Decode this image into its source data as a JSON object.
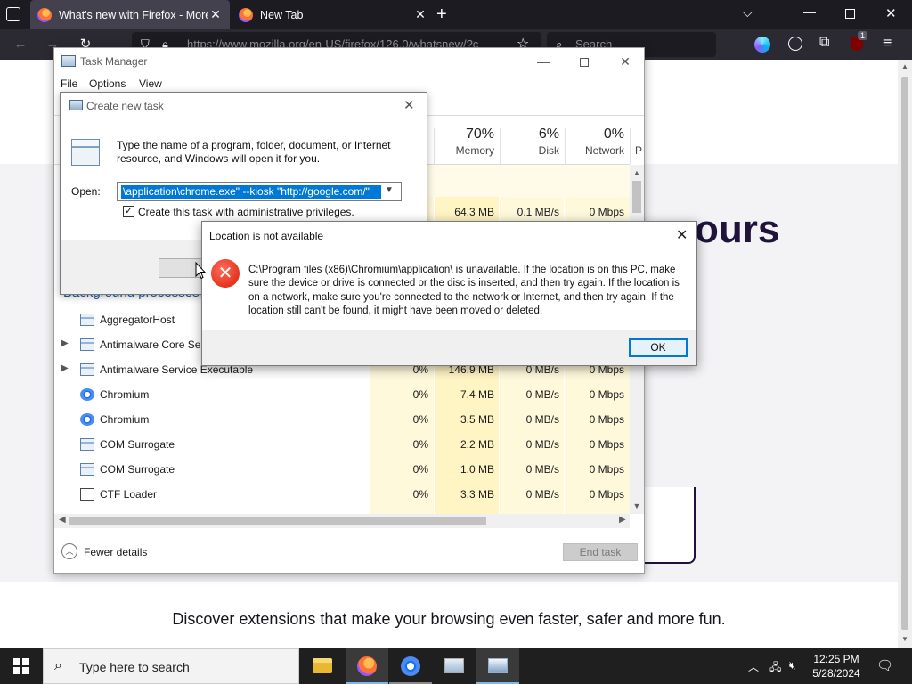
{
  "browser": {
    "tabs": [
      {
        "title": "What's new with Firefox - More"
      },
      {
        "title": "New Tab"
      }
    ],
    "url": "https://www.mozilla.org/en-US/firefox/126.0/whatsnew/?c",
    "search_placeholder": "Search",
    "extension_badge": "1"
  },
  "page": {
    "headline_fragment": "ours",
    "discover_text": "Discover extensions that make your browsing even faster, safer and more fun."
  },
  "task_manager": {
    "title": "Task Manager",
    "menu": [
      "File",
      "Options",
      "View"
    ],
    "columns": [
      {
        "percent": "70%",
        "name": "Memory"
      },
      {
        "percent": "6%",
        "name": "Disk"
      },
      {
        "percent": "0%",
        "name": "Network"
      },
      {
        "percent": "",
        "name": "P"
      }
    ],
    "first_row": {
      "memory": "64.3 MB",
      "disk": "0.1 MB/s",
      "network": "0 Mbps"
    },
    "section_label": "Background processes",
    "rows": [
      {
        "name": "AggregatorHost",
        "icon": "window-icon",
        "expandable": false,
        "cpu": "",
        "memory": "",
        "disk": "",
        "network": ""
      },
      {
        "name": "Antimalware Core Ser",
        "icon": "window-icon",
        "expandable": true,
        "cpu": "",
        "memory": "",
        "disk": "",
        "network": ""
      },
      {
        "name": "Antimalware Service Executable",
        "icon": "window-icon",
        "expandable": true,
        "cpu": "0%",
        "memory": "146.9 MB",
        "disk": "0 MB/s",
        "network": "0 Mbps"
      },
      {
        "name": "Chromium",
        "icon": "chromium-icon",
        "expandable": false,
        "cpu": "0%",
        "memory": "7.4 MB",
        "disk": "0 MB/s",
        "network": "0 Mbps"
      },
      {
        "name": "Chromium",
        "icon": "chromium-icon",
        "expandable": false,
        "cpu": "0%",
        "memory": "3.5 MB",
        "disk": "0 MB/s",
        "network": "0 Mbps"
      },
      {
        "name": "COM Surrogate",
        "icon": "window-icon",
        "expandable": false,
        "cpu": "0%",
        "memory": "2.2 MB",
        "disk": "0 MB/s",
        "network": "0 Mbps"
      },
      {
        "name": "COM Surrogate",
        "icon": "window-icon",
        "expandable": false,
        "cpu": "0%",
        "memory": "1.0 MB",
        "disk": "0 MB/s",
        "network": "0 Mbps"
      },
      {
        "name": "CTF Loader",
        "icon": "ctf-icon",
        "expandable": false,
        "cpu": "0%",
        "memory": "3.3 MB",
        "disk": "0 MB/s",
        "network": "0 Mbps"
      }
    ],
    "fewer_details": "Fewer details",
    "end_task": "End task"
  },
  "create_task": {
    "title": "Create new task",
    "description": "Type the name of a program, folder, document, or Internet resource, and Windows will open it for you.",
    "open_label": "Open:",
    "open_value": "\\application\\chrome.exe\" --kiosk \"http://google.com/\"",
    "admin_checkbox_label": "Create this task with administrative privileges.",
    "admin_checked": true
  },
  "error_dialog": {
    "title": "Location is not available",
    "message": "C:\\Program files (x86)\\Chromium\\application\\ is unavailable. If the location is on this PC, make sure the device or drive is connected or the disc is inserted, and then try again. If the location is on a network, make sure you're connected to the network or Internet, and then try again. If the location still can't be found, it might have been moved or deleted.",
    "ok_label": "OK"
  },
  "taskbar": {
    "search_placeholder": "Type here to search",
    "time": "12:25 PM",
    "date": "5/28/2024"
  },
  "colors": {
    "firefox_dark": "#1c1b22",
    "heat_yellow": "#fff4c4",
    "selection_blue": "#0078d7",
    "error_red": "#d81e06"
  }
}
